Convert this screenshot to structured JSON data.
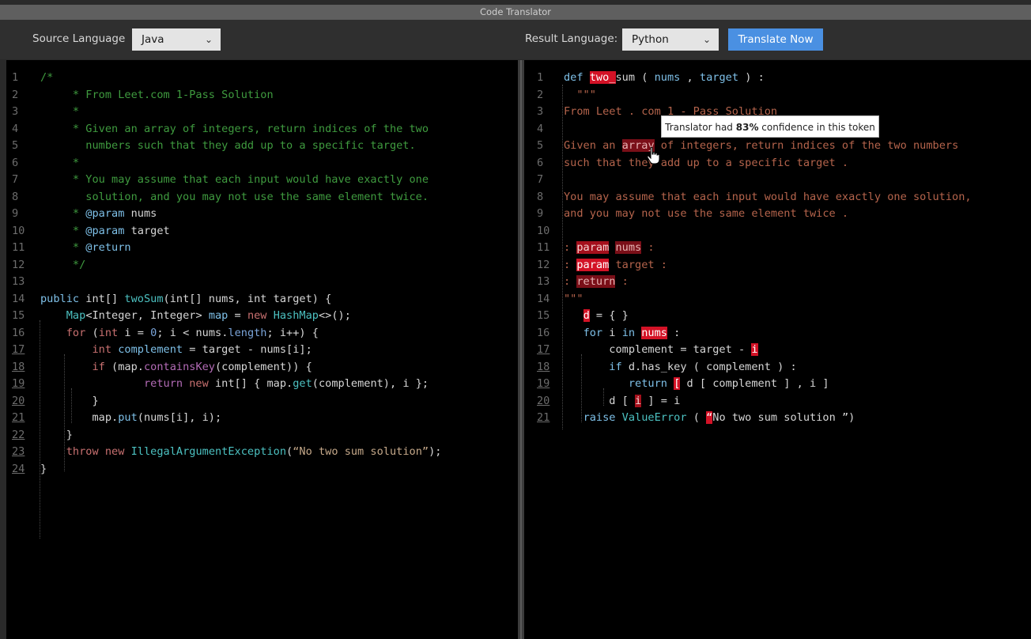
{
  "window": {
    "title": "Code Translator"
  },
  "toolbar": {
    "source_label": "Source Language",
    "source_value": "Java",
    "result_label": "Result Language:",
    "result_value": "Python",
    "translate_label": "Translate Now",
    "chevron": "⌄"
  },
  "source": {
    "lines": [
      {
        "n": "1",
        "u": false,
        "html": "<span class='g'>/*</span>"
      },
      {
        "n": "2",
        "u": false,
        "html": "<span class='g'>     * From Leet.com 1-Pass Solution</span>"
      },
      {
        "n": "3",
        "u": false,
        "html": "<span class='g'>     *</span>"
      },
      {
        "n": "4",
        "u": false,
        "html": "<span class='g'>     * Given an array of integers, return indices of the two</span>"
      },
      {
        "n": "5",
        "u": false,
        "html": "<span class='g'>       numbers such that they add up to a specific target.</span>"
      },
      {
        "n": "6",
        "u": false,
        "html": "<span class='g'>     *</span>"
      },
      {
        "n": "7",
        "u": false,
        "html": "<span class='g'>     * You may assume that each input would have exactly one</span>"
      },
      {
        "n": "8",
        "u": false,
        "html": "<span class='g'>       solution, and you may not use the same element twice.</span>"
      },
      {
        "n": "9",
        "u": false,
        "html": "<span class='g'>     * </span><span class='fn'>@param</span><span class='k'> nums</span>"
      },
      {
        "n": "10",
        "u": false,
        "html": "<span class='g'>     * </span><span class='fn'>@param</span><span class='k'> target</span>"
      },
      {
        "n": "11",
        "u": false,
        "html": "<span class='g'>     * </span><span class='fn'>@return</span>"
      },
      {
        "n": "12",
        "u": false,
        "html": "<span class='g'>     */</span>"
      },
      {
        "n": "13",
        "u": false,
        "html": ""
      },
      {
        "n": "14",
        "u": false,
        "html": "<span class='fn'>public</span><span class='k'> int[] </span><span class='ty'>twoSum</span><span class='k'>(int[] nums, int target) {</span>"
      },
      {
        "n": "15",
        "u": false,
        "html": "<span class='k'>    </span><span class='ty'>Map</span><span class='k'>&lt;Integer, Integer&gt; </span><span class='fn'>map</span><span class='k'> = </span><span class='kw'>new</span><span class='k'> </span><span class='ty'>HashMap</span><span class='k'>&lt;&gt;();</span>"
      },
      {
        "n": "16",
        "u": false,
        "html": "<span class='k'>    </span><span class='kw'>for</span><span class='k'> (</span><span class='kw'>int</span><span class='k'> i = </span><span class='nm'>0</span><span class='k'>; i &lt; nums.</span><span class='nm'>length</span><span class='k'>; i++) {</span>"
      },
      {
        "n": "17",
        "u": true,
        "html": "<span class='k'>        </span><span class='kw'>int</span><span class='k'> </span><span class='fn'>complement</span><span class='k'> = target - nums[i];</span>"
      },
      {
        "n": "18",
        "u": true,
        "html": "<span class='k'>        </span><span class='kw'>if</span><span class='k'> (map.</span><span class='pk'>containsKey</span><span class='k'>(complement)) {</span>"
      },
      {
        "n": "19",
        "u": true,
        "html": "<span class='k'>                </span><span class='pk'>return</span><span class='k'> </span><span class='kw'>new</span><span class='k'> int[] { map.</span><span class='ty'>get</span><span class='k'>(complement), i };</span>"
      },
      {
        "n": "20",
        "u": true,
        "html": "<span class='k'>        }</span>"
      },
      {
        "n": "21",
        "u": true,
        "html": "<span class='k'>        map.</span><span class='fn'>put</span><span class='k'>(nums[i], i);</span>"
      },
      {
        "n": "22",
        "u": true,
        "html": "<span class='k'>    }</span>"
      },
      {
        "n": "23",
        "u": true,
        "html": "<span class='k'>    </span><span class='kw'>throw new</span><span class='k'> </span><span class='ty'>IllegalArgumentException</span><span class='k'>(</span><span class='str'>“No two sum solution”</span><span class='k'>);</span>"
      },
      {
        "n": "24",
        "u": true,
        "html": "<span class='k'>}</span>"
      }
    ]
  },
  "result": {
    "lines": [
      {
        "n": "1",
        "u": false,
        "html": "<span class='fn'>def</span><span class='k'> </span><span class='hl3'>two_</span><span class='k'>sum ( </span><span class='fn'>nums</span><span class='k'> , </span><span class='fn'>target</span><span class='k'> ) :</span>"
      },
      {
        "n": "2",
        "u": false,
        "html": "<span class='doc'>  \"\"\"</span>"
      },
      {
        "n": "3",
        "u": false,
        "html": "<span class='doc'>From Leet . com 1 - Pass Solution</span>"
      },
      {
        "n": "4",
        "u": false,
        "html": ""
      },
      {
        "n": "5",
        "u": false,
        "html": "<span class='doc'>Given an </span><span class='hl'>array</span><span class='doc'> of integers, return indices of the two numbers</span>"
      },
      {
        "n": "6",
        "u": false,
        "html": "<span class='doc'>such that they add up to a specific target .</span>"
      },
      {
        "n": "7",
        "u": false,
        "html": ""
      },
      {
        "n": "8",
        "u": false,
        "html": "<span class='doc'>You may assume that each input would have exactly one solution,</span>"
      },
      {
        "n": "9",
        "u": false,
        "html": "<span class='doc'>and you may not use the same element twice .</span>"
      },
      {
        "n": "10",
        "u": false,
        "html": ""
      },
      {
        "n": "11",
        "u": false,
        "html": "<span class='doc'>: </span><span class='hl2'>param</span><span class='doc'> </span><span class='hl'>nums</span><span class='doc'> :</span>"
      },
      {
        "n": "12",
        "u": false,
        "html": "<span class='doc'>: </span><span class='hl3'>param</span><span class='doc'> target :</span>"
      },
      {
        "n": "13",
        "u": false,
        "html": "<span class='doc'>: </span><span class='hl'>return</span><span class='doc'> :</span>"
      },
      {
        "n": "14",
        "u": false,
        "html": "<span class='doc'>\"\"\"</span>"
      },
      {
        "n": "15",
        "u": false,
        "html": "<span class='k'>   </span><span class='hl3'>d</span><span class='k'> = { }</span>"
      },
      {
        "n": "16",
        "u": false,
        "html": "<span class='k'>   </span><span class='fn'>for</span><span class='k'> i </span><span class='fn'>in</span><span class='k'> </span><span class='hl3'>nums</span><span class='k'> :</span>"
      },
      {
        "n": "17",
        "u": true,
        "html": "<span class='k'>       complement = target - </span><span class='hl3'>i</span>"
      },
      {
        "n": "18",
        "u": true,
        "html": "<span class='k'>       </span><span class='fn'>if</span><span class='k'> d.has_key ( complement ) :</span>"
      },
      {
        "n": "19",
        "u": true,
        "html": "<span class='k'>          </span><span class='fn'>return</span><span class='k'> </span><span class='hl3'>[</span><span class='k'> d [ complement ] , i ]</span>"
      },
      {
        "n": "20",
        "u": true,
        "html": "<span class='k'>       d [ </span><span class='hl2'>i</span><span class='k'> ] = i</span>"
      },
      {
        "n": "21",
        "u": true,
        "html": "<span class='k'>   </span><span class='fn'>raise</span><span class='k'> </span><span class='ty'>ValueError</span><span class='k'> ( </span><span class='hl3'>“</span><span class='k'>No two sum solution ”)</span>"
      }
    ]
  },
  "tooltip": {
    "pre": "Translator had ",
    "pct": "83%",
    "post": " confidence in this token"
  },
  "colors": {
    "accent": "#4a90e2",
    "highlight_strong": "#d31226",
    "highlight_medium": "#a4101c",
    "highlight_weak": "#7a0f18"
  },
  "icons": {
    "chevron": "chevron-down-icon",
    "cursor": "hand-pointer-icon"
  }
}
